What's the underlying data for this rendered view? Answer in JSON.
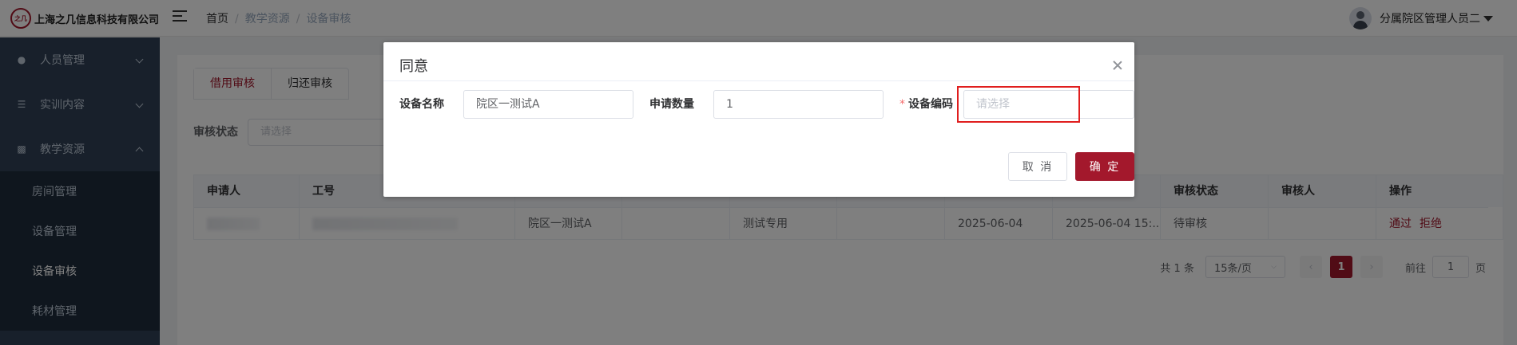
{
  "header": {
    "logo_mark": "之几",
    "company": "上海之几信息科技有限公司",
    "breadcrumb": [
      "首页",
      "教学资源",
      "设备审核"
    ],
    "user_name": "分属院区管理人员二"
  },
  "sidebar": {
    "items": [
      {
        "label": "人员管理"
      },
      {
        "label": "实训内容"
      },
      {
        "label": "教学资源"
      }
    ],
    "sub_items": [
      {
        "label": "房间管理"
      },
      {
        "label": "设备管理"
      },
      {
        "label": "设备审核"
      },
      {
        "label": "耗材管理"
      }
    ]
  },
  "main": {
    "tabs": [
      "借用审核",
      "归还审核"
    ],
    "filter_label": "审核状态",
    "filter_placeholder": "请选择",
    "table": {
      "headers": [
        "申请人",
        "工号",
        "",
        "",
        "",
        "",
        "",
        "",
        "审核状态",
        "审核人",
        "操作"
      ],
      "row": {
        "device": "院区一测试A",
        "purpose": "测试专用",
        "date": "2025-06-04",
        "datetime": "2025-06-04 15:...",
        "status": "待审核",
        "approve": "通过",
        "reject": "拒绝"
      }
    },
    "pager": {
      "total": "共 1 条",
      "page_size": "15条/页",
      "current": "1",
      "goto_prefix": "前往",
      "goto_value": "1",
      "goto_suffix": "页"
    }
  },
  "dialog": {
    "title": "同意",
    "fields": {
      "name_label": "设备名称",
      "name_value": "院区一测试A",
      "qty_label": "申请数量",
      "qty_value": "1",
      "code_label": "设备编码",
      "code_placeholder": "请选择"
    },
    "cancel": "取 消",
    "ok": "确 定"
  },
  "colors": {
    "accent": "#a3182c",
    "sidebar": "#304156",
    "highlight": "#e01e1e"
  }
}
